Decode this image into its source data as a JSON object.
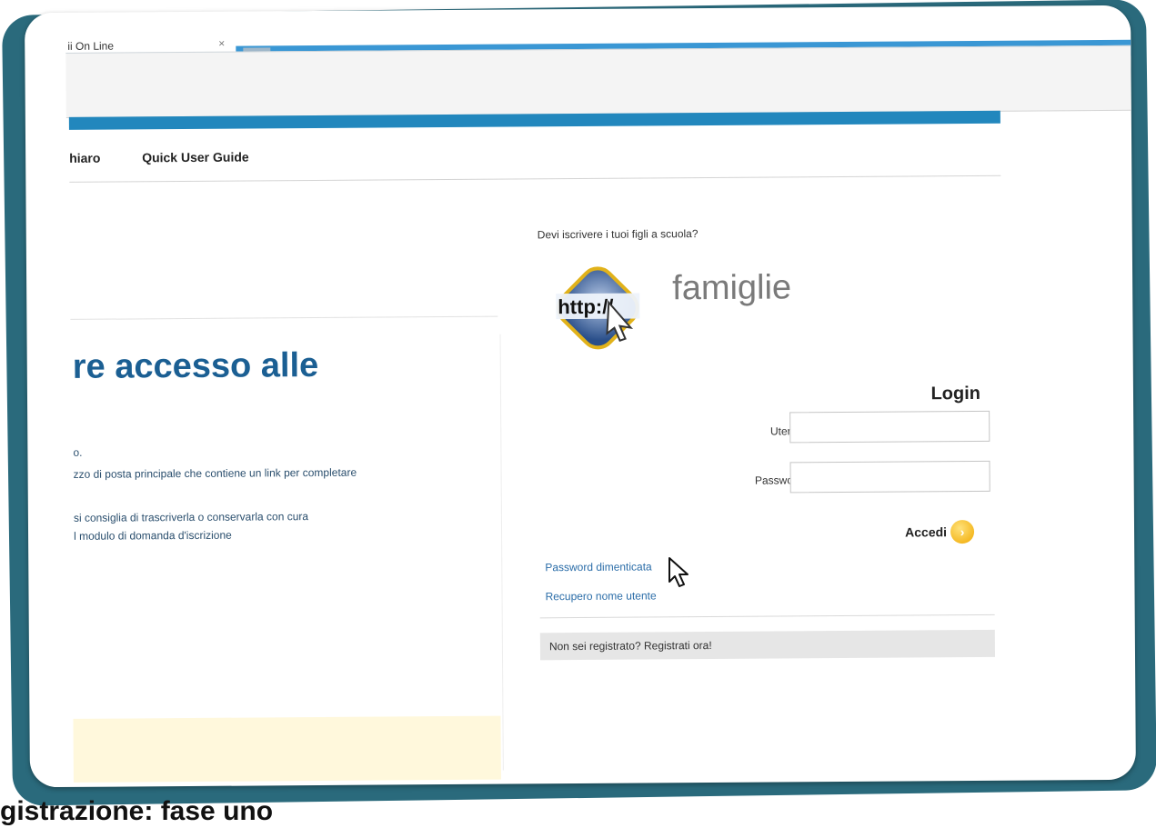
{
  "browser": {
    "tab_title": "ii On Line",
    "tab_close": "×"
  },
  "nav": {
    "items": [
      "hiaro",
      "Quick User Guide"
    ]
  },
  "left": {
    "heading": "re accesso alle",
    "instructions": [
      "o.",
      "zzo di posta principale che contiene un link per completare",
      "si consiglia di trascriverla o conservarla con cura",
      "l modulo di domanda d'iscrizione"
    ]
  },
  "right": {
    "enroll_question": "Devi iscrivere i tuoi figli a scuola?",
    "logo_badge_text": "http://",
    "logo_text": "famiglie",
    "login_title": "Login",
    "username_label": "Utente",
    "password_label": "Password",
    "username_value": "",
    "password_value": "",
    "submit_label": "Accedi",
    "submit_icon": "arrow-right-icon",
    "forgot_password": "Password dimenticata",
    "recover_username": "Recupero nome utente",
    "register_prompt": "Non sei registrato? Registrati ora!"
  },
  "caption": "gistrazione: fase uno",
  "colors": {
    "frame": "#2a6a7c",
    "accent": "#2287bd",
    "heading": "#1b5f93",
    "link": "#2b6da8",
    "button_icon": "#f0a800"
  }
}
